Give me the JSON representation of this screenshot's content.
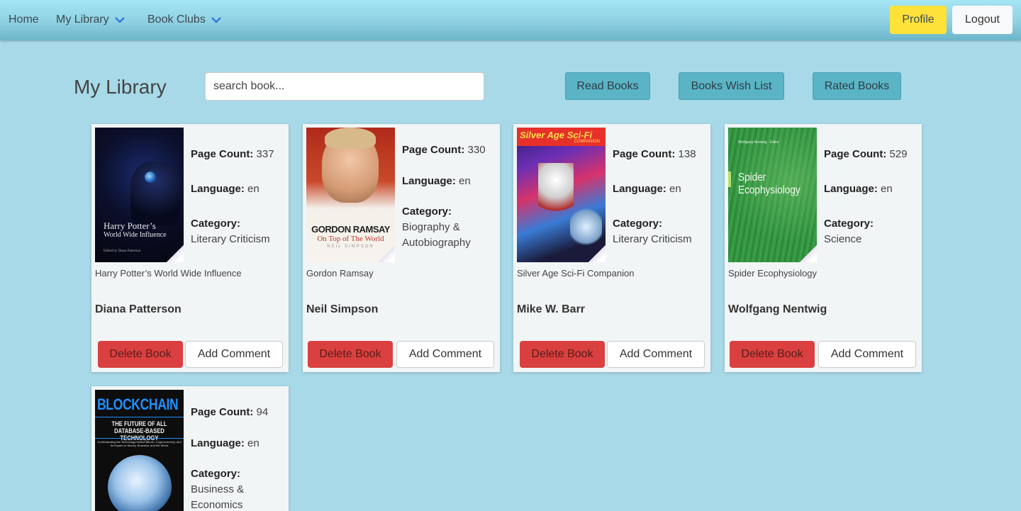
{
  "nav": {
    "home": "Home",
    "my_library": "My Library",
    "book_clubs": "Book Clubs",
    "profile": "Profile",
    "logout": "Logout"
  },
  "header": {
    "title": "My Library",
    "search_placeholder": "search book...",
    "read_books": "Read Books",
    "wish_list": "Books Wish List",
    "rated_books": "Rated Books"
  },
  "labels": {
    "page_count": "Page Count:",
    "language": "Language:",
    "category": "Category:",
    "delete": "Delete Book",
    "comment": "Add Comment"
  },
  "books": [
    {
      "page_count": "337",
      "language": "en",
      "category": "Literary Criticism",
      "title": "Harry Potter’s World Wide Influence",
      "author": "Diana Patterson",
      "cover_title": "Harry Potter’s",
      "cover_sub": "World Wide Influence",
      "cover_credit": "Edited by Diana Patterson"
    },
    {
      "page_count": "330",
      "language": "en",
      "category": "Biography & Autobiography",
      "title": "Gordon Ramsay",
      "author": "Neil Simpson",
      "cover_title": "GORDON RAMSAY",
      "cover_sub": "On Top of The World",
      "cover_credit": "NEIL SIMPSON"
    },
    {
      "page_count": "138",
      "language": "en",
      "category": "Literary Criticism",
      "title": "Silver Age Sci-Fi Companion",
      "author": "Mike W. Barr",
      "cover_title": "Silver Age Sci-Fi",
      "cover_sub": "COMPANION"
    },
    {
      "page_count": "529",
      "language": "en",
      "category": "Science",
      "title": "Spider Ecophysiology",
      "author": "Wolfgang Nentwig",
      "cover_credit": "Wolfgang Nentwig · Editor",
      "cover_title": "Spider",
      "cover_sub": "Ecophysiology"
    },
    {
      "page_count": "94",
      "language": "en",
      "category": "Business & Economics",
      "cover_title": "BLOCKCHAIN",
      "cover_sub": "THE FUTURE OF ALL DATABASE-BASED TECHNOLOGY",
      "cover_credit": "Understanding the Technology behind Bitcoin, Cryptocurrency, and its Impact on Money, Business, and the World"
    }
  ]
}
